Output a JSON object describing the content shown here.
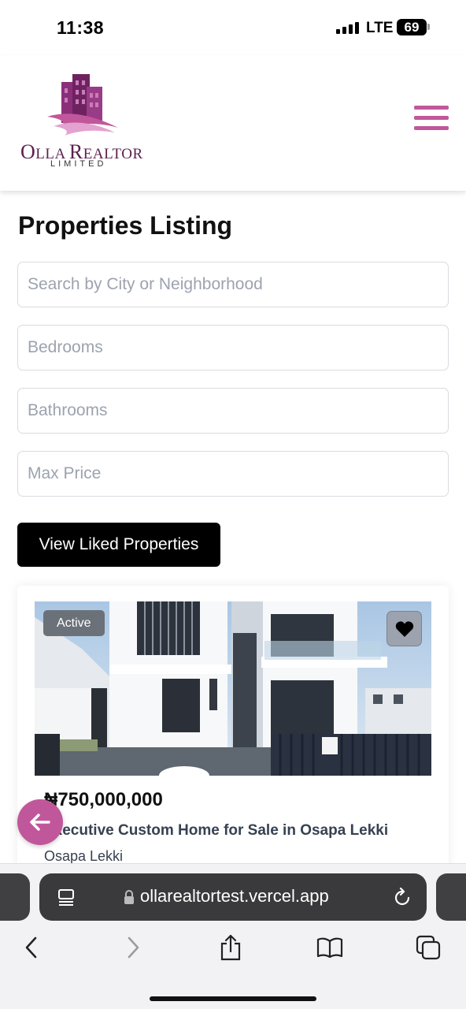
{
  "status_bar": {
    "time": "11:38",
    "network": "LTE",
    "battery": "69"
  },
  "header": {
    "logo_name": "Olla Realtor",
    "logo_subtitle": "LIMITED",
    "menu_icon": "hamburger-menu-icon",
    "brand_color": "#c1579b"
  },
  "main": {
    "title": "Properties Listing",
    "filters": {
      "search_placeholder": "Search by City or Neighborhood",
      "bedrooms_placeholder": "Bedrooms",
      "bathrooms_placeholder": "Bathrooms",
      "max_price_placeholder": "Max Price"
    },
    "liked_button_label": "View Liked Properties"
  },
  "listing": {
    "status_badge": "Active",
    "price": "₦750,000,000",
    "title": "Executive Custom Home for Sale in Osapa Lekki",
    "location": "Osapa Lekki",
    "favorite_icon": "heart-icon"
  },
  "browser": {
    "url": "ollarealtortest.vercel.app",
    "icons": [
      "page-menu-icon",
      "lock-icon",
      "reload-icon",
      "back-icon",
      "forward-icon",
      "share-icon",
      "bookmarks-icon",
      "tabs-icon"
    ]
  }
}
